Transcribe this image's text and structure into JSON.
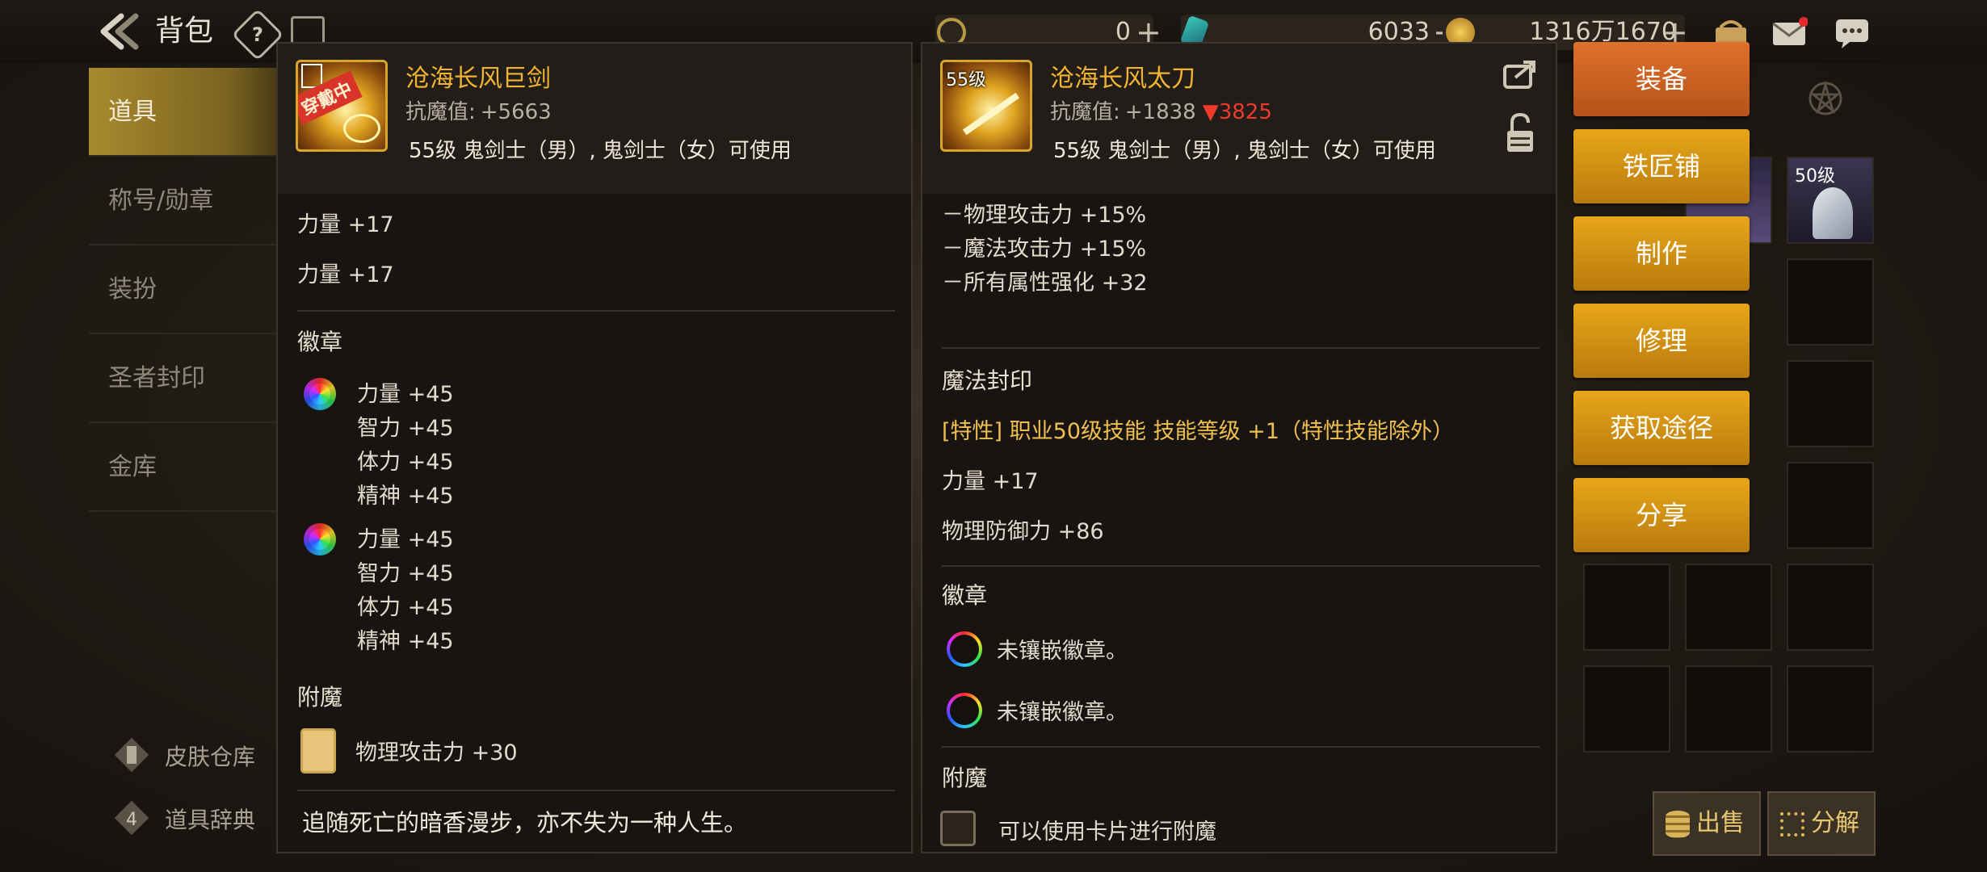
{
  "topbar": {
    "title": "背包",
    "help_label": "?",
    "currency": [
      {
        "icon": "coin-c-icon",
        "value": "0"
      },
      {
        "icon": "crystal-icon",
        "value": "6033"
      },
      {
        "icon": "gold-coin-icon",
        "value": "1316万1670"
      }
    ],
    "plus": "+"
  },
  "sidebar": {
    "items": [
      {
        "label": "道具",
        "active": true
      },
      {
        "label": "称号/勋章"
      },
      {
        "label": "装扮"
      },
      {
        "label": "圣者封印"
      },
      {
        "label": "金库"
      }
    ],
    "footer": [
      {
        "label": "皮肤仓库"
      },
      {
        "label": "道具辞典"
      }
    ]
  },
  "left_panel": {
    "badge": "穿戴中",
    "name": "沧海长风巨剑",
    "resist_label": "抗魔值:",
    "resist_value": "+5663",
    "usable": "55级 鬼剑士（男）, 鬼剑士（女）可使用",
    "stats": [
      "力量 +17",
      "力量 +17"
    ],
    "emblem_title": "徽章",
    "emblems": [
      {
        "lines": [
          "力量 +45",
          "智力 +45",
          "体力 +45",
          "精神 +45"
        ]
      },
      {
        "lines": [
          "力量 +45",
          "智力 +45",
          "体力 +45",
          "精神 +45"
        ]
      }
    ],
    "enchant_title": "附魔",
    "enchant": "物理攻击力 +30",
    "flavor": "追随死亡的暗香漫步，亦不失为一种人生。"
  },
  "right_panel": {
    "level_badge": "55级",
    "name": "沧海长风太刀",
    "resist_label": "抗魔值:",
    "resist_value": "+1838",
    "resist_diff": "▼3825",
    "usable": "55级 鬼剑士（男）, 鬼剑士（女）可使用",
    "stats_top": [
      "－物理攻击力 +15%",
      "－魔法攻击力 +15%",
      "－所有属性强化 +32"
    ],
    "seal_title": "魔法封印",
    "seal_trait": "[特性] 职业50级技能 技能等级 +1（特性技能除外）",
    "seal_stats": [
      "力量 +17",
      "物理防御力 +86"
    ],
    "emblem_title": "徽章",
    "emblems": [
      "未镶嵌徽章。",
      "未镶嵌徽章。"
    ],
    "enchant_title": "附魔",
    "enchant": "可以使用卡片进行附魔"
  },
  "actions": [
    "装备",
    "铁匠铺",
    "制作",
    "修理",
    "获取途径",
    "分享"
  ],
  "inventory": {
    "slot_level": "50级",
    "sell": "出售",
    "decompose": "分解"
  }
}
